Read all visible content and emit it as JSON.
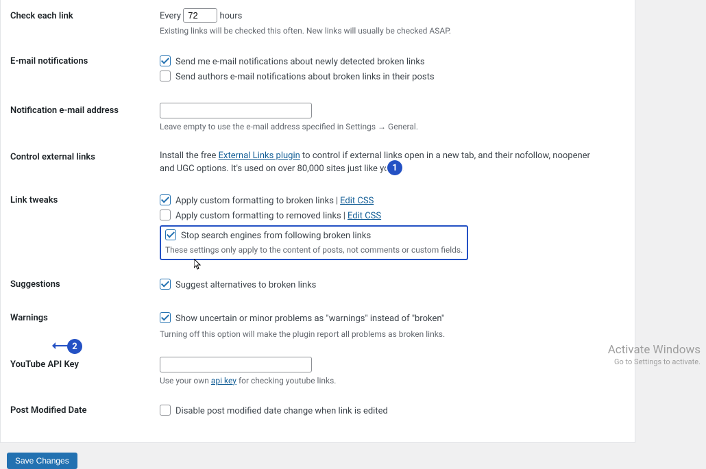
{
  "rows": {
    "check_each": {
      "label": "Check each link",
      "prefix": "Every",
      "value": "72",
      "suffix": "hours",
      "desc": "Existing links will be checked this often. New links will usually be checked ASAP."
    },
    "email": {
      "label": "E-mail notifications",
      "opt1": "Send me e-mail notifications about newly detected broken links",
      "opt2": "Send authors e-mail notifications about broken links in their posts"
    },
    "notif_addr": {
      "label": "Notification e-mail address",
      "value": "",
      "desc": "Leave empty to use the e-mail address specified in Settings → General."
    },
    "external": {
      "label": "Control external links",
      "text_before": "Install the free ",
      "link": "External Links plugin",
      "text_after": " to control if external links open in a new tab, and their nofollow, noopener and UGC options. It's used on over 80,000 sites just like yours."
    },
    "tweaks": {
      "label": "Link tweaks",
      "opt1": "Apply custom formatting to broken links",
      "opt1_link": "Edit CSS",
      "opt2": "Apply custom formatting to removed links",
      "opt2_link": "Edit CSS",
      "opt3": "Stop search engines from following broken links",
      "desc": "These settings only apply to the content of posts, not comments or custom fields."
    },
    "suggestions": {
      "label": "Suggestions",
      "opt1": "Suggest alternatives to broken links"
    },
    "warnings": {
      "label": "Warnings",
      "opt1": "Show uncertain or minor problems as \"warnings\" instead of \"broken\"",
      "desc": "Turning off this option will make the plugin report all problems as broken links."
    },
    "yt": {
      "label": "YouTube API Key",
      "value": "",
      "desc_before": "Use your own ",
      "desc_link": "api key",
      "desc_after": " for checking youtube links."
    },
    "post_mod": {
      "label": "Post Modified Date",
      "opt1": "Disable post modified date change when link is edited"
    }
  },
  "save_button": "Save Changes",
  "callouts": {
    "one": "1",
    "two": "2"
  },
  "watermark": {
    "title": "Activate Windows",
    "sub": "Go to Settings to activate."
  }
}
